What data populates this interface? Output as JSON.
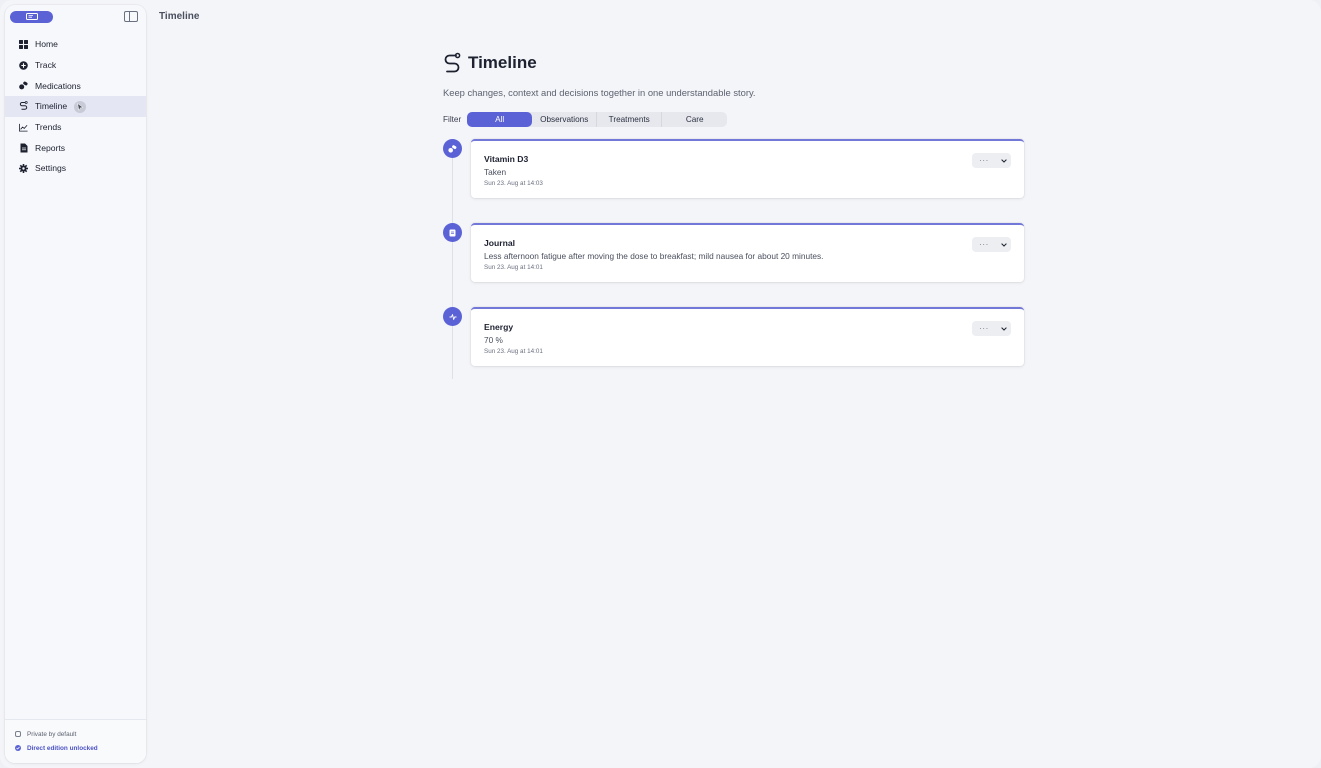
{
  "app": {
    "window_title": "Timeline"
  },
  "sidebar": {
    "logo_icon": "book-icon",
    "toggle_icon": "sidebar-toggle-icon",
    "items": [
      {
        "label": "Home",
        "icon": "grid-icon",
        "active": false
      },
      {
        "label": "Track",
        "icon": "plus-circle-icon",
        "active": false
      },
      {
        "label": "Medications",
        "icon": "pills-icon",
        "active": false
      },
      {
        "label": "Timeline",
        "icon": "timeline-icon",
        "active": true
      },
      {
        "label": "Trends",
        "icon": "chart-line-icon",
        "active": false
      },
      {
        "label": "Reports",
        "icon": "document-icon",
        "active": false
      },
      {
        "label": "Settings",
        "icon": "gear-icon",
        "active": false
      }
    ],
    "footer": {
      "private_label": "Private by default",
      "edition_label": "Direct edition unlocked"
    }
  },
  "main": {
    "title": "Timeline",
    "subtitle": "Keep changes, context and decisions together in one understandable story.",
    "filter": {
      "label": "Filter",
      "options": [
        "All",
        "Observations",
        "Treatments",
        "Care"
      ],
      "selected": "All"
    },
    "entries": [
      {
        "icon": "pills-icon",
        "title": "Vitamin D3",
        "body": "Taken",
        "time": "Sun 23. Aug at 14:03",
        "more_label": "···"
      },
      {
        "icon": "journal-icon",
        "title": "Journal",
        "body": "Less afternoon fatigue after moving the dose to breakfast; mild nausea for about 20 minutes.",
        "time": "Sun 23. Aug at 14:01",
        "more_label": "···"
      },
      {
        "icon": "pulse-icon",
        "title": "Energy",
        "body": "70 %",
        "time": "Sun 23. Aug at 14:01",
        "more_label": "···"
      }
    ]
  },
  "colors": {
    "accent": "#5b62d6",
    "background": "#f4f5f9",
    "card": "#ffffff"
  }
}
